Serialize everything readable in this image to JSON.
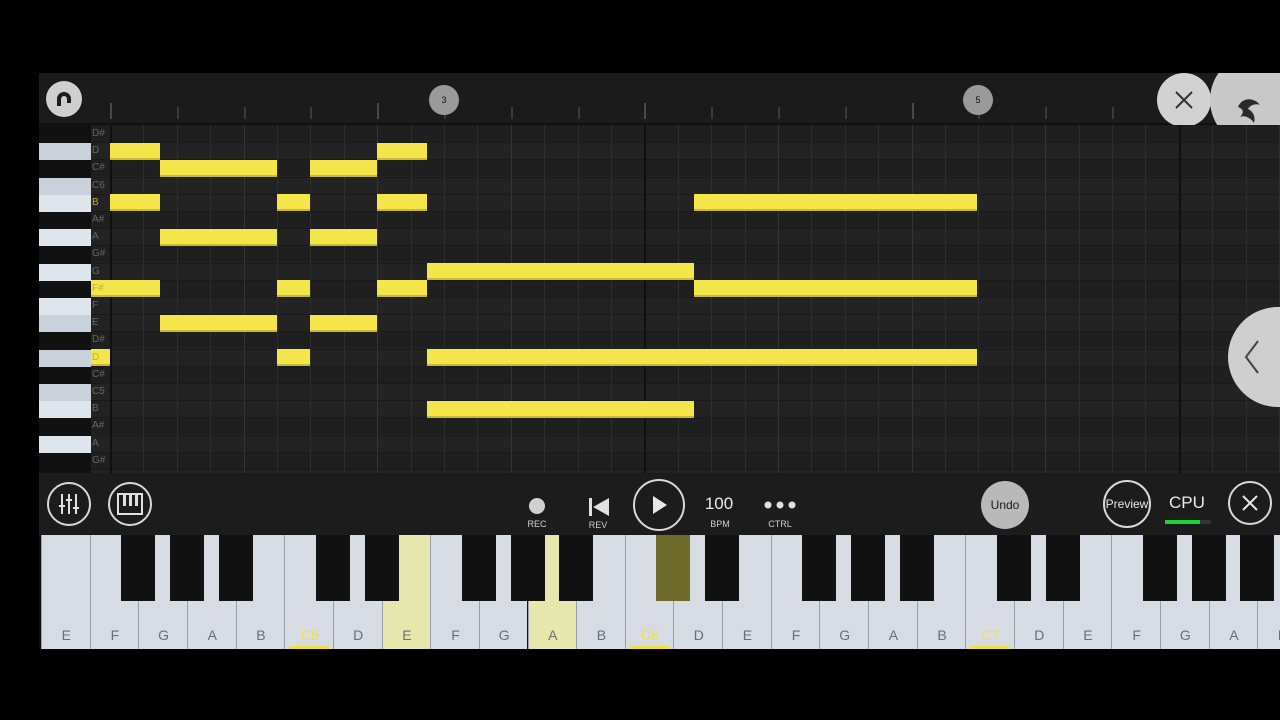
{
  "ruler": {
    "bar_markers": [
      "3",
      "5"
    ]
  },
  "side_labels": [
    "D#",
    "D",
    "C#",
    "C6",
    "B",
    "A#",
    "A",
    "G#",
    "G",
    "F#",
    "F",
    "E",
    "D#",
    "D",
    "C#",
    "C5",
    "B",
    "A#",
    "A",
    "G#"
  ],
  "transport": {
    "rec_label": "REC",
    "rev_label": "REV",
    "bpm_value": "100",
    "bpm_label": "BPM",
    "ctrl_label": "CTRL",
    "undo_label": "Undo",
    "preview_label": "Preview",
    "cpu_label": "CPU",
    "cpu_level": 0.75
  },
  "keyboard": {
    "white_keys": [
      {
        "label": "E"
      },
      {
        "label": "F"
      },
      {
        "label": "G"
      },
      {
        "label": "A"
      },
      {
        "label": "B"
      },
      {
        "label": "C5",
        "octave": true
      },
      {
        "label": "D"
      },
      {
        "label": "E",
        "active": true
      },
      {
        "label": "F"
      },
      {
        "label": "G"
      },
      {
        "label": "A",
        "active": true
      },
      {
        "label": "B"
      },
      {
        "label": "C6",
        "octave": true
      },
      {
        "label": "D"
      },
      {
        "label": "E"
      },
      {
        "label": "F"
      },
      {
        "label": "G"
      },
      {
        "label": "A"
      },
      {
        "label": "B"
      },
      {
        "label": "C7",
        "octave": true
      },
      {
        "label": "D"
      },
      {
        "label": "E"
      },
      {
        "label": "F"
      },
      {
        "label": "G"
      },
      {
        "label": "A"
      },
      {
        "label": "B"
      }
    ]
  },
  "colors": {
    "note": "#f4e54a",
    "octave_label": "#f3e232",
    "cpu_meter": "#20d23a",
    "background": "#202020"
  },
  "icons": [
    "magnet-icon",
    "close-icon",
    "fl-logo-icon",
    "chevron-left-icon",
    "mixer-icon",
    "piano-icon",
    "record-icon",
    "rewind-icon",
    "play-icon",
    "more-icon"
  ]
}
